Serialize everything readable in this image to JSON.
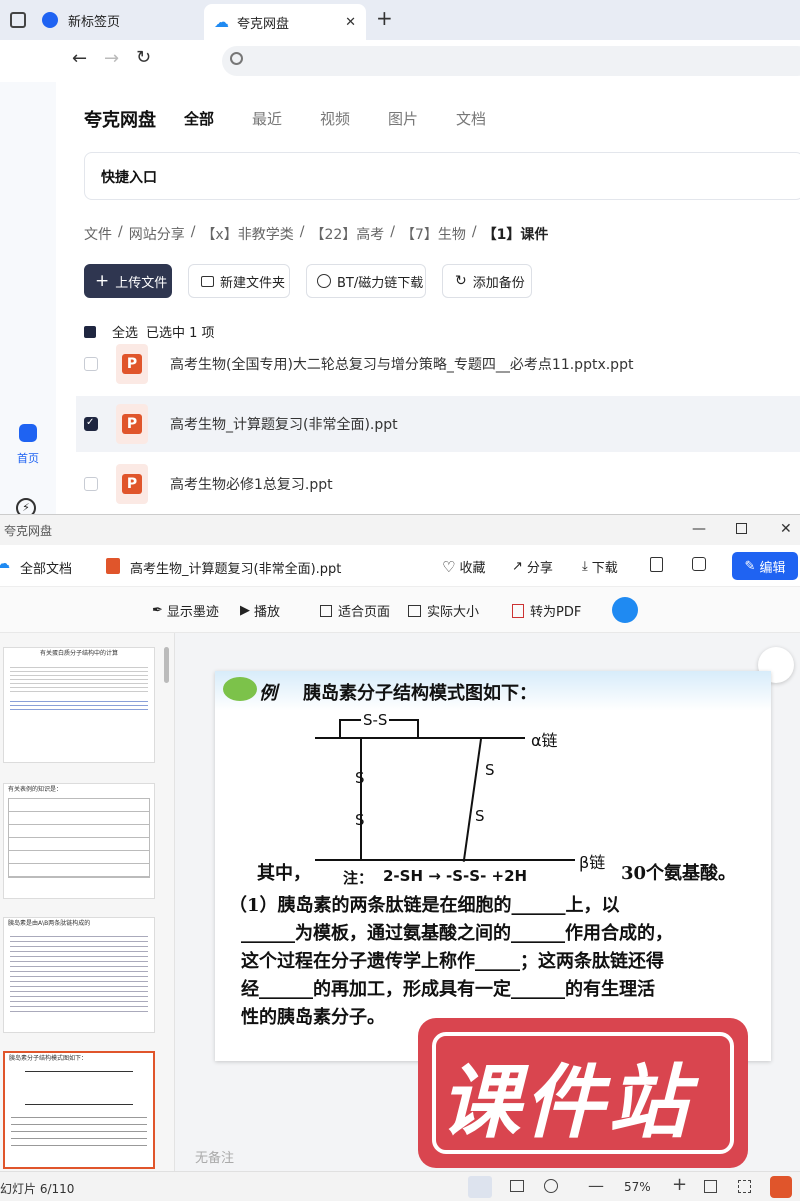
{
  "browser": {
    "tabs": [
      {
        "label": "新标签页"
      },
      {
        "label": "夸克网盘"
      }
    ],
    "new_tab": "+",
    "close": "✕"
  },
  "sidebar": {
    "home_label": "首页"
  },
  "drive": {
    "brand": "夸克网盘",
    "nav": [
      "全部",
      "最近",
      "视频",
      "图片",
      "文档"
    ],
    "quick_entry": "快捷入口",
    "breadcrumb": [
      "文件",
      "网站分享",
      "【x】非教学类",
      "【22】高考",
      "【7】生物",
      "【1】课件"
    ],
    "breadcrumb_sep": "/",
    "actions": {
      "upload": "上传文件",
      "new_folder": "新建文件夹",
      "bt": "BT/磁力链下载",
      "backup": "添加备份"
    },
    "select_all": "全选",
    "selected_info": "已选中 1 项",
    "files": [
      {
        "name": "高考生物(全国专用)大二轮总复习与增分策略_专题四__必考点11.pptx.ppt",
        "checked": false
      },
      {
        "name": "高考生物_计算题复习(非常全面).ppt",
        "checked": true
      },
      {
        "name": "高考生物必修1总复习.ppt",
        "checked": false
      }
    ]
  },
  "viewer": {
    "window_title": "夸克网盘",
    "all_docs": "全部文档",
    "file_name": "高考生物_计算题复习(非常全面).ppt",
    "actions": {
      "favorite": "收藏",
      "share": "分享",
      "download": "下载",
      "edit": "编辑"
    },
    "tools": {
      "show_ink": "显示墨迹",
      "play": "播放",
      "fit_page": "适合页面",
      "actual_size": "实际大小",
      "to_pdf": "转为PDF"
    },
    "no_notes": "无备注",
    "status": {
      "slide_counter": "幻灯片 6/110",
      "zoom": "57%"
    }
  },
  "slide": {
    "example": "例",
    "title": "胰岛素分子结构模式图如下：",
    "ss_top": "S-S",
    "alpha": "α链",
    "beta": "β链",
    "s_left": [
      "S",
      "S"
    ],
    "s_right": [
      "S",
      "S"
    ],
    "note_prefix": "注：",
    "note": "2-SH → -S-S- +2H",
    "q0_a": "其中，",
    "q0_b": "30个氨基酸。",
    "q1": "（1）胰岛素的两条肽链是在细胞的______上，以",
    "q2": "______为模板，通过氨基酸之间的______作用合成的，",
    "q3": "这个过程在分子遗传学上称作_____；这两条肽链还得",
    "q4": "经______的再加工，形成具有一定______的有生理活",
    "q5": "性的胰岛素分子。"
  },
  "thumbnails": [
    {
      "title": "有关蛋白质分子结构中的计算"
    },
    {
      "title": "有关表例的知识是："
    },
    {
      "title": "胰岛素是由A\\B两条肽链构成的"
    },
    {
      "title": "胰岛素分子结构模式图如下："
    }
  ],
  "watermark": {
    "text": "课件站"
  },
  "colors": {
    "accent": "#1f63f2",
    "ppt": "#e0552b",
    "watermark": "#d9454f"
  }
}
